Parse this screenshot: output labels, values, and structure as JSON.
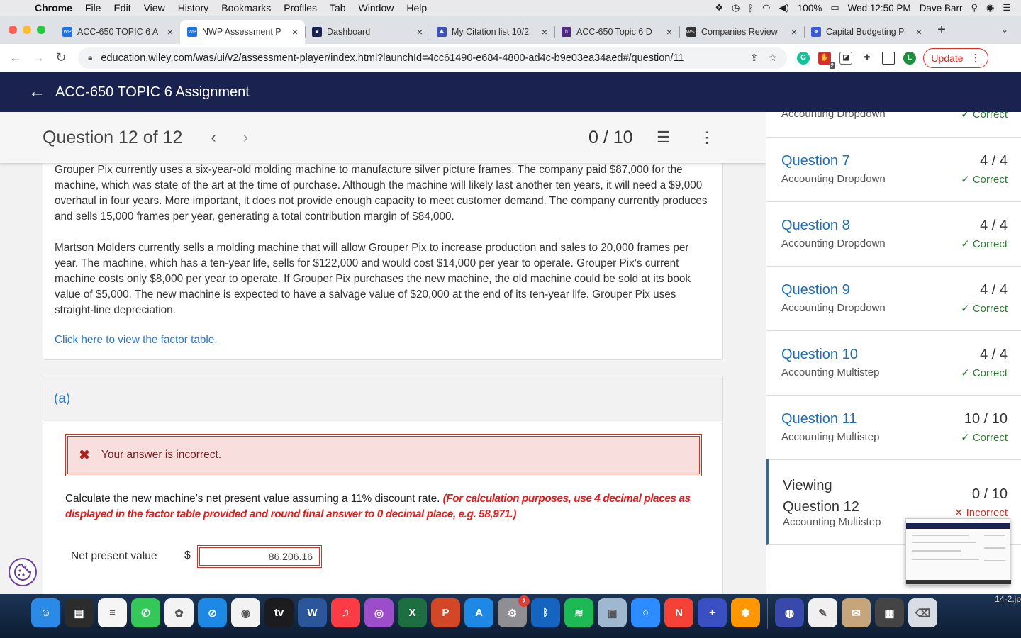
{
  "menubar": {
    "app": "Chrome",
    "items": [
      "File",
      "Edit",
      "View",
      "History",
      "Bookmarks",
      "Profiles",
      "Tab",
      "Window",
      "Help"
    ],
    "battery": "100%",
    "datetime": "Wed 12:50 PM",
    "user": "Dave Barr"
  },
  "tabs": [
    {
      "title": "ACC-650 TOPIC 6 A",
      "favicon": "WP",
      "color": "#1a73e8"
    },
    {
      "title": "NWP Assessment P",
      "favicon": "WP",
      "color": "#1a73e8",
      "active": true
    },
    {
      "title": "Dashboard",
      "favicon": "★",
      "color": "#1a2250"
    },
    {
      "title": "My Citation list 10/2",
      "favicon": "⛰",
      "color": "#3f51b5"
    },
    {
      "title": "ACC-650 Topic 6 D",
      "favicon": "h",
      "color": "#4b2c7d"
    },
    {
      "title": "Companies Review",
      "favicon": "WSJ",
      "color": "#333333"
    },
    {
      "title": "Capital Budgeting P",
      "favicon": "❖",
      "color": "#3b5bdb"
    }
  ],
  "address": {
    "url": "education.wiley.com/was/ui/v2/assessment-player/index.html?launchId=4cc61490-e684-4800-ad4c-b9e03ea34aed#/question/11",
    "update_label": "Update",
    "ext_badge": "2",
    "profile_initial": "L"
  },
  "app": {
    "title": "ACC-650 TOPIC 6 Assignment"
  },
  "question": {
    "title": "Question 12 of 12",
    "score": "0 / 10",
    "paragraph1": "Grouper Pix currently uses a six-year-old molding machine to manufacture silver picture frames. The company paid $87,000 for the machine, which was state of the art at the time of purchase. Although the machine will likely last another ten years, it will need a $9,000 overhaul in four years. More important, it does not provide enough capacity to meet customer demand. The company currently produces and sells 15,000 frames per year, generating a total contribution margin of $84,000.",
    "paragraph2": "Martson Molders currently sells a molding machine that will allow Grouper Pix to increase production and sales to 20,000 frames per year. The machine, which has a ten-year life, sells for $122,000 and would cost $14,000 per year to operate. Grouper Pix’s current machine costs only $8,000 per year to operate. If Grouper Pix purchases the new machine, the old machine could be sold at its book value of $5,000. The new machine is expected to have a salvage value of $20,000 at the end of its ten-year life. Grouper Pix uses straight-line depreciation.",
    "factor_link": "Click here to view the factor table."
  },
  "part": {
    "label": "(a)",
    "alert": "Your answer is incorrect.",
    "instruction": "Calculate the new machine’s net present value assuming a 11% discount rate.",
    "instruction_red": "(For calculation purposes, use 4 decimal places as displayed in the factor table provided and round final answer to 0 decimal place, e.g. 58,971.)",
    "npv_label": "Net present value",
    "currency": "$",
    "npv_value": "86,206.16"
  },
  "sidebar": {
    "partial_top": {
      "type": "Accounting Dropdown",
      "status": "✓ Correct"
    },
    "items": [
      {
        "q": "Question 7",
        "score": "4 / 4",
        "type": "Accounting Dropdown",
        "status": "✓ Correct"
      },
      {
        "q": "Question 8",
        "score": "4 / 4",
        "type": "Accounting Dropdown",
        "status": "✓ Correct"
      },
      {
        "q": "Question 9",
        "score": "4 / 4",
        "type": "Accounting Dropdown",
        "status": "✓ Correct"
      },
      {
        "q": "Question 10",
        "score": "4 / 4",
        "type": "Accounting Multistep",
        "status": "✓ Correct"
      },
      {
        "q": "Question 11",
        "score": "10 / 10",
        "type": "Accounting Multistep",
        "status": "✓ Correct"
      }
    ],
    "viewing": {
      "line1": "Viewing",
      "line2": "Question 12",
      "type": "Accounting Multistep",
      "score": "0 / 10",
      "status": "✕ Incorrect"
    }
  },
  "dock": {
    "apps": [
      {
        "name": "finder",
        "label": "☺",
        "color": "#2b8ae6"
      },
      {
        "name": "activity",
        "label": "▤",
        "color": "#2c2c2c"
      },
      {
        "name": "notes",
        "label": "≡",
        "color": "#f5f5f5"
      },
      {
        "name": "facetime",
        "label": "✆",
        "color": "#34c759"
      },
      {
        "name": "photos",
        "label": "✿",
        "color": "#f3f3f3"
      },
      {
        "name": "safari",
        "label": "⊘",
        "color": "#1e88e5"
      },
      {
        "name": "chrome",
        "label": "◉",
        "color": "#f2f2f2"
      },
      {
        "name": "tv",
        "label": "tv",
        "color": "#1c1c1e"
      },
      {
        "name": "word",
        "label": "W",
        "color": "#2b579a"
      },
      {
        "name": "music",
        "label": "♫",
        "color": "#fc3c44"
      },
      {
        "name": "podcasts",
        "label": "◎",
        "color": "#9b4dca"
      },
      {
        "name": "excel",
        "label": "X",
        "color": "#1d6f42"
      },
      {
        "name": "powerpoint",
        "label": "P",
        "color": "#d24726"
      },
      {
        "name": "appstore",
        "label": "A",
        "color": "#1e88e5"
      },
      {
        "name": "settings",
        "label": "⚙",
        "color": "#8e8e93",
        "badge": "2"
      },
      {
        "name": "bluetooth",
        "label": "ᛒ",
        "color": "#1565c0"
      },
      {
        "name": "spotify",
        "label": "≋",
        "color": "#1db954"
      },
      {
        "name": "preview",
        "label": "▣",
        "color": "#9fb8d0"
      },
      {
        "name": "zoom",
        "label": "○",
        "color": "#2d8cff"
      },
      {
        "name": "news",
        "label": "N",
        "color": "#f44336"
      },
      {
        "name": "screenshot",
        "label": "+",
        "color": "#3a4fc2"
      },
      {
        "name": "flower",
        "label": "✽",
        "color": "#ff9800"
      },
      {
        "name": "network",
        "label": "◍",
        "color": "#3949ab"
      },
      {
        "name": "textedit",
        "label": "✎",
        "color": "#f0f0f0"
      },
      {
        "name": "preview2",
        "label": "✉",
        "color": "#c7a57a"
      },
      {
        "name": "printer",
        "label": "▦",
        "color": "#444444"
      },
      {
        "name": "trash",
        "label": "⌫",
        "color": "#d8dde3"
      }
    ],
    "desk_file": "14-2.jp"
  }
}
